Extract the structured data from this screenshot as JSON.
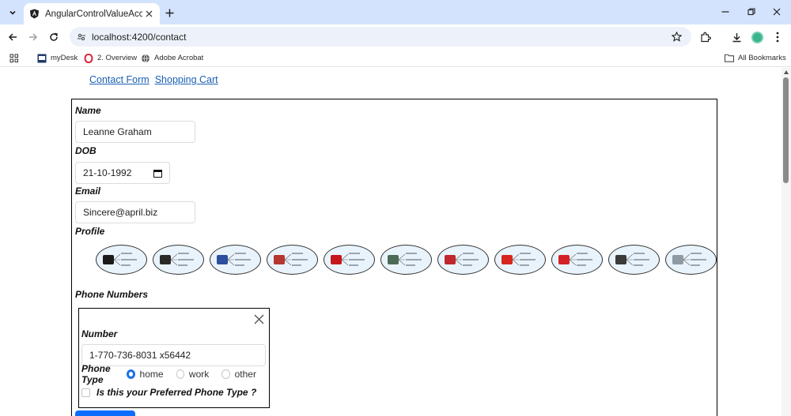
{
  "browser": {
    "tab_title": "AngularControlValueAccessor",
    "url": "localhost:4200/contact",
    "bookmarks": [
      {
        "label": "myDesk",
        "icon": "mydesk-icon"
      },
      {
        "label": "2. Overview",
        "icon": "opera-icon"
      },
      {
        "label": "Adobe Acrobat",
        "icon": "globe-icon"
      }
    ],
    "all_bookmarks": "All Bookmarks"
  },
  "nav": {
    "contact_form": "Contact Form",
    "shopping_cart": "Shopping Cart"
  },
  "form": {
    "name_label": "Name",
    "name_value": "Leanne Graham",
    "dob_label": "DOB",
    "dob_value": "21-10-1992",
    "email_label": "Email",
    "email_value": "Sincere@april.biz",
    "profile_label": "Profile",
    "profiles": [
      {
        "name": "batman",
        "color": "#1b1b1b"
      },
      {
        "name": "black-panther",
        "color": "#2a2a2a"
      },
      {
        "name": "captain-america",
        "color": "#2c4f9e"
      },
      {
        "name": "avengers-mountains",
        "color": "#b5372f"
      },
      {
        "name": "flash",
        "color": "#c4161c"
      },
      {
        "name": "green-lantern",
        "color": "#4c6b57"
      },
      {
        "name": "iron-man",
        "color": "#c0262c"
      },
      {
        "name": "albania-eagle",
        "color": "#d7261e"
      },
      {
        "name": "superman",
        "color": "#d42027"
      },
      {
        "name": "rifle-bird",
        "color": "#3a3a3a"
      },
      {
        "name": "eagle",
        "color": "#8f9aa5"
      }
    ],
    "phone_numbers_label": "Phone Numbers",
    "phone": {
      "number_label": "Number",
      "number_value": "1-770-736-8031 x56442",
      "type_label": "Phone Type",
      "types": [
        "home",
        "work",
        "other"
      ],
      "selected_type": "home",
      "preferred_label": "Is this your Preferred Phone Type ?",
      "preferred_checked": false
    }
  },
  "colors": {
    "link": "#1a5fb4",
    "accent": "#1a73e8",
    "button": "#0d6efd",
    "tabstrip": "#d3e3fd"
  }
}
